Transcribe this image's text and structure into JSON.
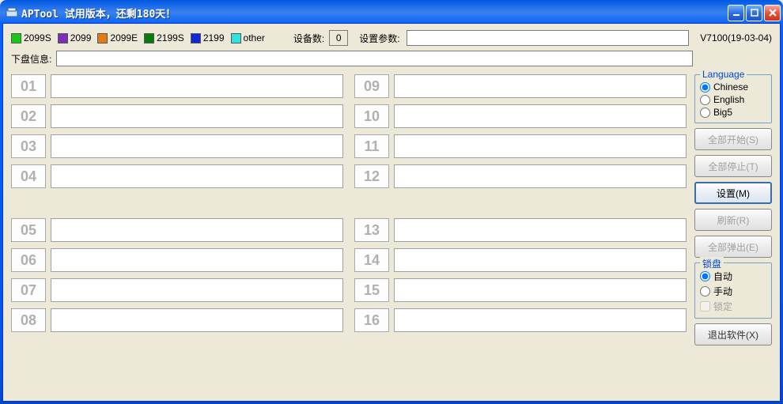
{
  "title": "APTool  试用版本，还剩180天！",
  "legend": [
    {
      "label": "2099S",
      "color": "#16c916"
    },
    {
      "label": "2099",
      "color": "#7b2fb9"
    },
    {
      "label": "2099E",
      "color": "#e07b16"
    },
    {
      "label": "2199S",
      "color": "#0a7a0a"
    },
    {
      "label": "2199",
      "color": "#1427d6"
    },
    {
      "label": "other",
      "color": "#33e0e0"
    }
  ],
  "device": {
    "label": "设备数:",
    "value": "0"
  },
  "params": {
    "label": "设置参数:",
    "value": ""
  },
  "version": "V7100(19-03-04)",
  "info": {
    "label": "下盘信息:",
    "value": ""
  },
  "slots_left": [
    "01",
    "02",
    "03",
    "04",
    "05",
    "06",
    "07",
    "08"
  ],
  "slots_right": [
    "09",
    "10",
    "11",
    "12",
    "13",
    "14",
    "15",
    "16"
  ],
  "language": {
    "title": "Language",
    "options": [
      "Chinese",
      "English",
      "Big5"
    ],
    "selected": "Chinese"
  },
  "buttons": {
    "start_all": "全部开始(S)",
    "stop_all": "全部停止(T)",
    "settings": "设置(M)",
    "refresh": "刷新(R)",
    "eject_all": "全部弹出(E)",
    "exit": "退出软件(X)"
  },
  "lock": {
    "title": "锁盘",
    "auto": "自动",
    "manual": "手动",
    "lock": "锁定",
    "selected": "自动"
  }
}
